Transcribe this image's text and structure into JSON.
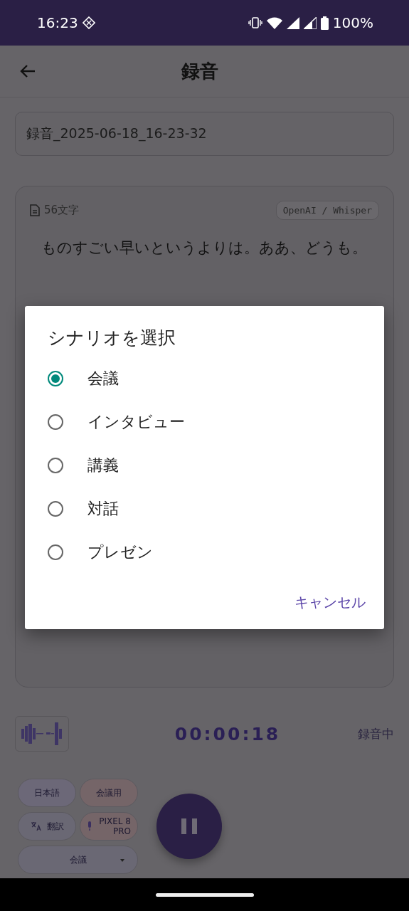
{
  "status_bar": {
    "time": "16:23",
    "battery": "100%"
  },
  "app_bar": {
    "title": "録音"
  },
  "filename_field": {
    "value": "録音_2025-06-18_16-23-32"
  },
  "transcript": {
    "char_count": "56文字",
    "engine": "OpenAI / Whisper",
    "text": "ものすごい早いというよりは。ああ、どうも。"
  },
  "recorder": {
    "timer": "00:00:18",
    "status": "録音中"
  },
  "chips": [
    {
      "label": "日本語",
      "kind": "language"
    },
    {
      "label": "会議用",
      "kind": "preset"
    },
    {
      "label": "翻訳",
      "kind": "translate"
    },
    {
      "label": "PIXEL 8 PRO",
      "kind": "mic"
    }
  ],
  "scenario_dropdown": {
    "value": "会議"
  },
  "dialog": {
    "title": "シナリオを選択",
    "options": [
      {
        "label": "会議",
        "selected": true
      },
      {
        "label": "インタビュー",
        "selected": false
      },
      {
        "label": "講義",
        "selected": false
      },
      {
        "label": "対話",
        "selected": false
      },
      {
        "label": "プレゼン",
        "selected": false
      }
    ],
    "cancel": "キャンセル"
  }
}
